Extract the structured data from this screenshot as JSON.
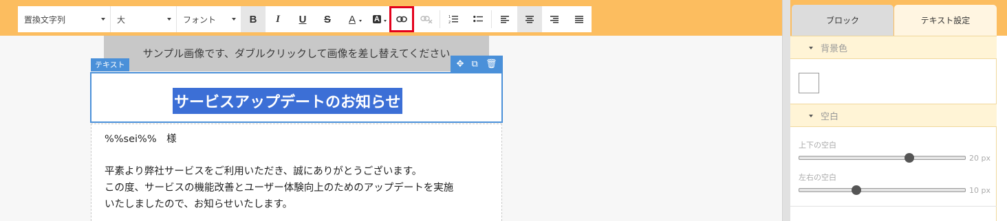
{
  "toolbar": {
    "font_select": "置換文字列",
    "size_select": "大",
    "family_select": "フォント",
    "bold": "B",
    "italic": "I",
    "underline": "U",
    "strike": "S",
    "font_color": "A",
    "bg_color": "A"
  },
  "editor": {
    "image_placeholder": "サンプル画像です、ダブルクリックして画像を差し替えてください",
    "block_badge": "テキスト",
    "title": "サービスアップデートのお知らせ",
    "body": {
      "greeting": "%%sei%%　様",
      "line1": "平素より弊社サービスをご利用いただき、誠にありがとうございます。",
      "line2": "この度、サービスの機能改善とユーザー体験向上のためのアップデートを実施",
      "line3": "いたしましたので、お知らせいたします。"
    }
  },
  "panel": {
    "tabs": [
      "ブロック",
      "テキスト設定"
    ],
    "active_tab": "テキスト設定",
    "bg_section": "背景色",
    "bg_color": "#ffffff",
    "spacing_section": "空白",
    "vertical_label": "上下の空白",
    "vertical_value": "20 px",
    "vertical_fraction": 0.66,
    "horizontal_label": "左右の空白",
    "horizontal_value": "10 px",
    "horizontal_fraction": 0.34
  },
  "colors": {
    "accent_orange": "#fcbd5f",
    "selection_blue": "#4a90d9",
    "highlight_red": "#e3001b"
  }
}
